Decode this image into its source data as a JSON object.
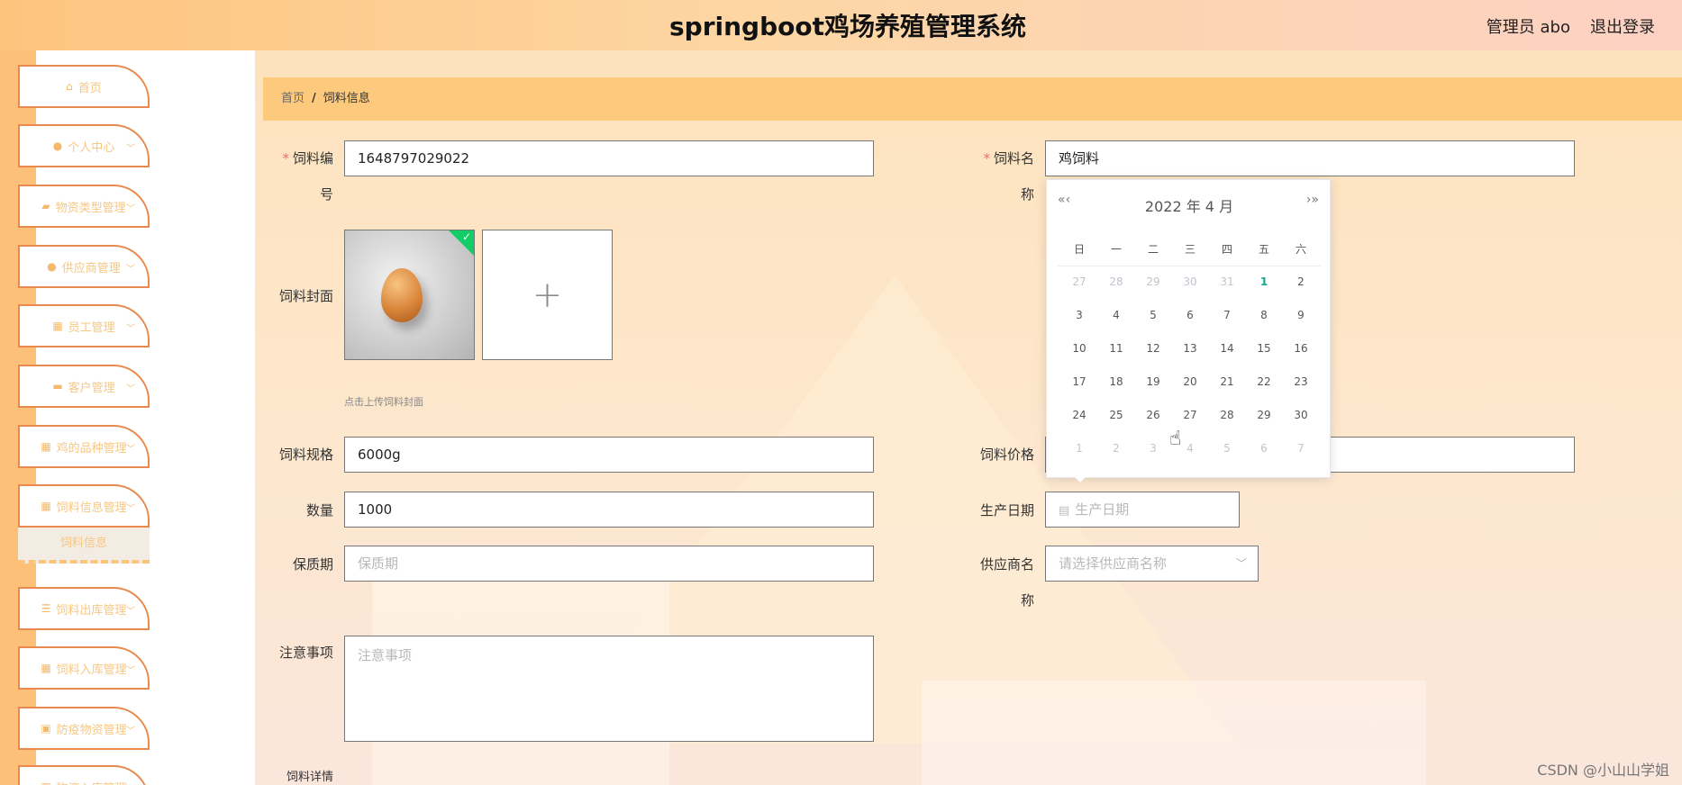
{
  "header": {
    "title": "springboot鸡场养殖管理系统",
    "user": "管理员 abo",
    "logout": "退出登录"
  },
  "sidebar": {
    "items": [
      {
        "label": "首页",
        "icon": "home-icon",
        "glyph": "⌂",
        "chevron": false
      },
      {
        "label": "个人中心",
        "icon": "user-icon",
        "glyph": "●",
        "chevron": true
      },
      {
        "label": "物资类型管理",
        "icon": "thumb-icon",
        "glyph": "▰",
        "chevron": true
      },
      {
        "label": "供应商管理",
        "icon": "pin-icon",
        "glyph": "●",
        "chevron": true
      },
      {
        "label": "员工管理",
        "icon": "grid-icon",
        "glyph": "▦",
        "chevron": true
      },
      {
        "label": "客户管理",
        "icon": "briefcase-icon",
        "glyph": "▬",
        "chevron": true
      },
      {
        "label": "鸡的品种管理",
        "icon": "grid-icon",
        "glyph": "▦",
        "chevron": true
      },
      {
        "label": "饲料信息管理",
        "icon": "grid-icon",
        "glyph": "▦",
        "chevron": true
      },
      {
        "label": "饲料出库管理",
        "icon": "sliders-icon",
        "glyph": "☰",
        "chevron": true
      },
      {
        "label": "饲料入库管理",
        "icon": "grid-icon",
        "glyph": "▦",
        "chevron": true
      },
      {
        "label": "防疫物资管理",
        "icon": "card-icon",
        "glyph": "▣",
        "chevron": true
      },
      {
        "label": "物资入库管理",
        "icon": "grid-icon",
        "glyph": "▦",
        "chevron": true
      }
    ],
    "active_sub": "饲料信息"
  },
  "breadcrumb": {
    "home": "首页",
    "sep": "/",
    "current": "饲料信息"
  },
  "form": {
    "feed_no": {
      "label_1": "饲料编",
      "label_2": "号",
      "value": "1648797029022"
    },
    "feed_name": {
      "label_1": "饲料名",
      "label_2": "称",
      "value": "鸡饲料"
    },
    "cover": {
      "label": "饲料封面",
      "hint": "点击上传饲料封面",
      "add": "+"
    },
    "spec": {
      "label": "饲料规格",
      "value": "6000g"
    },
    "price": {
      "label": "饲料价格"
    },
    "quantity": {
      "label": "数量",
      "value": "1000"
    },
    "production_date": {
      "label": "生产日期",
      "placeholder": "生产日期"
    },
    "shelf_life": {
      "label": "保质期",
      "placeholder": "保质期"
    },
    "supplier": {
      "label_1": "供应商名",
      "label_2": "称",
      "placeholder": "请选择供应商名称"
    },
    "notes": {
      "label": "注意事项",
      "placeholder": "注意事项"
    },
    "details": {
      "label": "饲料详情"
    }
  },
  "datepicker": {
    "header": "2022 年  4 月",
    "prev": "«‹",
    "next": "›»",
    "weekdays": [
      "日",
      "一",
      "二",
      "三",
      "四",
      "五",
      "六"
    ],
    "weeks": [
      [
        "27",
        "28",
        "29",
        "30",
        "31",
        "1",
        "2"
      ],
      [
        "3",
        "4",
        "5",
        "6",
        "7",
        "8",
        "9"
      ],
      [
        "10",
        "11",
        "12",
        "13",
        "14",
        "15",
        "16"
      ],
      [
        "17",
        "18",
        "19",
        "20",
        "21",
        "22",
        "23"
      ],
      [
        "24",
        "25",
        "26",
        "27",
        "28",
        "29",
        "30"
      ],
      [
        "1",
        "2",
        "3",
        "4",
        "5",
        "6",
        "7"
      ]
    ],
    "today": "1"
  },
  "watermark": "CSDN @小山山学姐",
  "colors": {
    "accent": "#fdc97c",
    "sidebar_border": "#e98a4c",
    "sidebar_text": "#f7c783",
    "success": "#13ce66"
  }
}
